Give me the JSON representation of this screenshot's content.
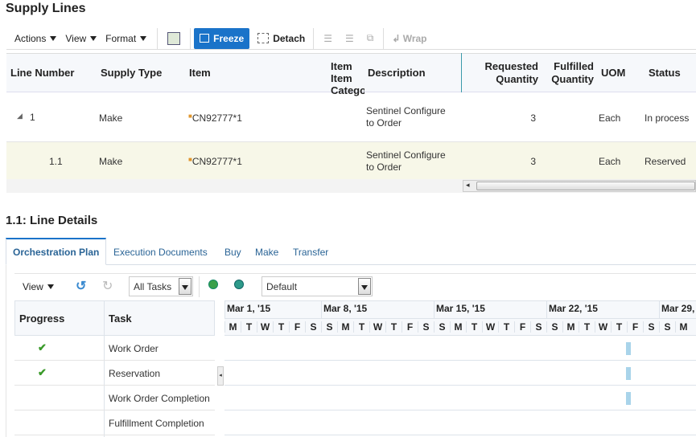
{
  "supply": {
    "title": "Supply Lines",
    "toolbar": {
      "actions": "Actions",
      "view": "View",
      "format": "Format",
      "freeze": "Freeze",
      "detach": "Detach",
      "wrap": "Wrap"
    },
    "columns": [
      "Line Number",
      "Supply Type",
      "Item",
      "Item Catego",
      "Description",
      "Requested",
      "Quantity",
      "Fulfilled",
      "Quantity",
      "UOM",
      "Status"
    ],
    "rows": [
      {
        "line": "1",
        "type": "Make",
        "item": "CN92777*1",
        "desc1": "Sentinel Configure",
        "desc2": "to Order",
        "req": "3",
        "uom": "Each",
        "status": "In process"
      },
      {
        "line": "1.1",
        "type": "Make",
        "item": "CN92777*1",
        "desc1": "Sentinel Configure",
        "desc2": "to Order",
        "req": "3",
        "uom": "Each",
        "status": "Reserved"
      }
    ]
  },
  "details": {
    "title": "1.1: Line Details",
    "tabs": [
      "Orchestration Plan",
      "Execution Documents",
      "Buy",
      "Make",
      "Transfer"
    ],
    "toolbar": {
      "view": "View",
      "filter": "All Tasks",
      "layout": "Default"
    },
    "columns": {
      "progress": "Progress",
      "task": "Task"
    },
    "weeks": [
      "Mar 1, '15",
      "Mar 8, '15",
      "Mar 15, '15",
      "Mar 22, '15",
      "Mar 29,"
    ],
    "days": [
      "M",
      "T",
      "W",
      "T",
      "F",
      "S",
      "S",
      "M",
      "T",
      "W",
      "T",
      "F",
      "S",
      "S",
      "M",
      "T",
      "W",
      "T",
      "F",
      "S",
      "S",
      "M",
      "T",
      "W",
      "T",
      "F",
      "S",
      "S",
      "M"
    ],
    "tasks": [
      {
        "name": "Work Order",
        "done": true
      },
      {
        "name": "Reservation",
        "done": true
      },
      {
        "name": "Work Order Completion",
        "done": false
      },
      {
        "name": "Fulfillment Completion",
        "done": false
      }
    ]
  },
  "colors": {
    "accent": "#1a73c9",
    "selected_row": "#f7f7e8",
    "bar": "#a9d4ea"
  }
}
